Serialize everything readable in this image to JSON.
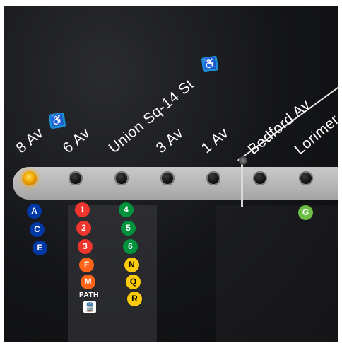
{
  "stations": [
    {
      "name": "8 Av",
      "ada": true,
      "lit": true
    },
    {
      "name": "6 Av",
      "ada": false,
      "lit": false
    },
    {
      "name": "Union Sq-14 St",
      "ada": true,
      "lit": false
    },
    {
      "name": "3 Av",
      "ada": false,
      "lit": false
    },
    {
      "name": "1 Av",
      "ada": false,
      "lit": false
    },
    {
      "name": "Bedford Av",
      "ada": false,
      "lit": false
    },
    {
      "name": "Lorimer",
      "ada": false,
      "lit": false
    }
  ],
  "ada_symbol": "♿",
  "transfers": {
    "8av": [
      {
        "label": "A",
        "color": "#0039a6"
      },
      {
        "label": "C",
        "color": "#0039a6"
      },
      {
        "label": "E",
        "color": "#0039a6"
      }
    ],
    "6av": [
      {
        "label": "1",
        "color": "#ee352e"
      },
      {
        "label": "2",
        "color": "#ee352e"
      },
      {
        "label": "3",
        "color": "#ee352e"
      },
      {
        "label": "F",
        "color": "#ff6319"
      },
      {
        "label": "M",
        "color": "#ff6319"
      }
    ],
    "union_sq": [
      {
        "label": "4",
        "color": "#00933c"
      },
      {
        "label": "5",
        "color": "#00933c"
      },
      {
        "label": "6",
        "color": "#00933c"
      },
      {
        "label": "N",
        "color": "#fccc0a"
      },
      {
        "label": "Q",
        "color": "#fccc0a"
      },
      {
        "label": "R",
        "color": "#fccc0a"
      }
    ],
    "lorimer": [
      {
        "label": "G",
        "color": "#6cbe45"
      }
    ]
  },
  "path": {
    "label": "PATH",
    "icon": "train-icon",
    "glyph": "🚆"
  }
}
